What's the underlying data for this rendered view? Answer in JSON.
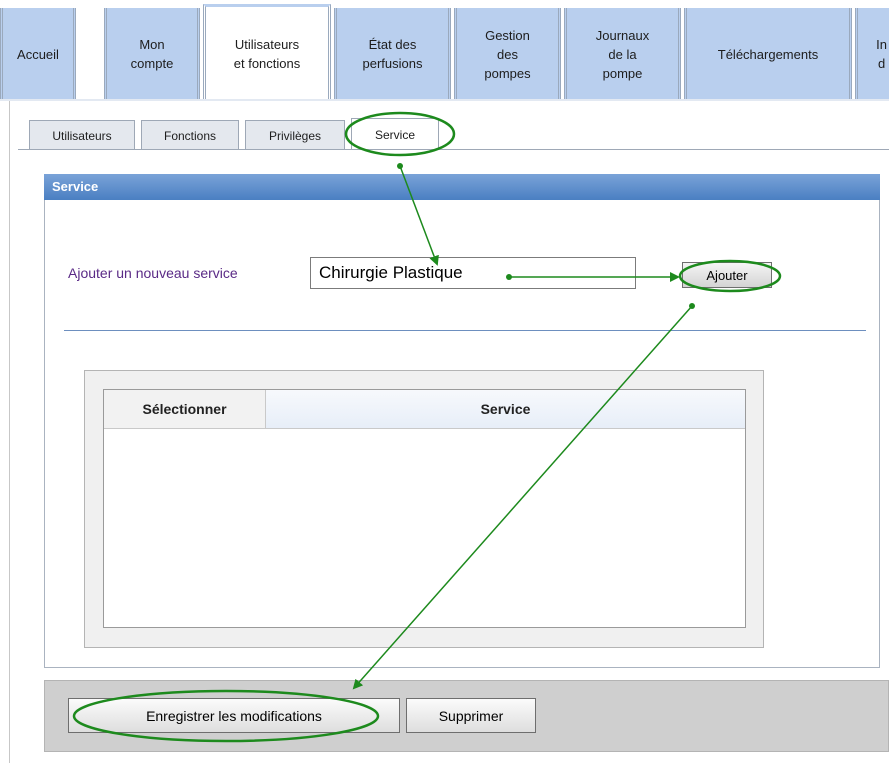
{
  "nav": {
    "tabs": [
      {
        "label": "Accueil"
      },
      {
        "label": "Mon\ncompte"
      },
      {
        "label": "Utilisateurs\net fonctions"
      },
      {
        "label": "État des\nperfusions"
      },
      {
        "label": "Gestion\ndes\npompes"
      },
      {
        "label": "Journaux\nde la\npompe"
      },
      {
        "label": "Téléchargements"
      },
      {
        "label": "In\nd"
      }
    ],
    "active_index": 2
  },
  "subtabs": [
    {
      "label": "Utilisateurs"
    },
    {
      "label": "Fonctions"
    },
    {
      "label": "Privilèges"
    },
    {
      "label": "Service"
    }
  ],
  "panel": {
    "title": "Service",
    "add_label": "Ajouter un nouveau service",
    "input_value": "Chirurgie Plastique",
    "add_button": "Ajouter"
  },
  "table": {
    "columns": [
      "Sélectionner",
      "Service"
    ],
    "rows": []
  },
  "footer": {
    "save_button": "Enregistrer les modifications",
    "delete_button": "Supprimer"
  },
  "colors": {
    "nav_tab": "#b9cfee",
    "panel_header": "#4a7fc2",
    "annotation": "#1d8a1d",
    "label_text": "#5a2a86"
  }
}
